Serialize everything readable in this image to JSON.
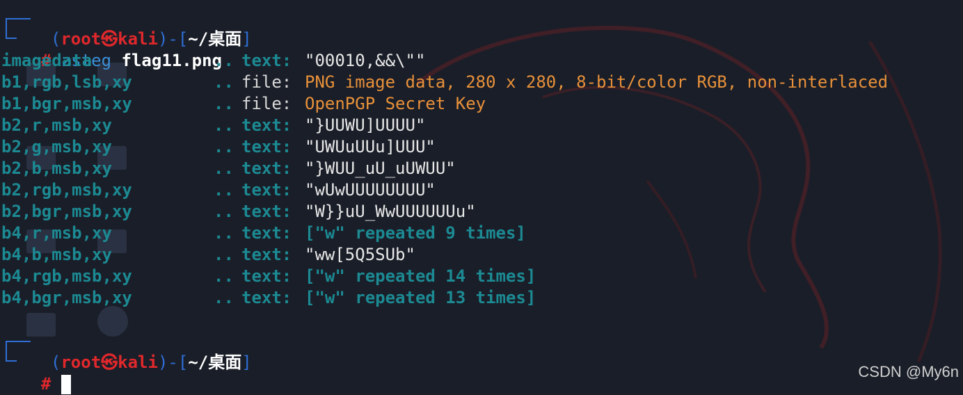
{
  "prompt": {
    "open": "(",
    "user": "root",
    "at_symbol": "㉿",
    "host": "kali",
    "sep": ")-[",
    "path": "~/桌面",
    "close": "]",
    "hash": "#"
  },
  "command": {
    "program": "zsteg",
    "argument": "flag11.png"
  },
  "results": [
    {
      "key": "imagedata",
      "dots": "..",
      "type": "text:",
      "value": "\"00010,&&\\\"\"",
      "style": "plain"
    },
    {
      "key": "b1,rgb,lsb,xy",
      "dots": "..",
      "type": "file:",
      "value": "PNG image data, 280 x 280, 8-bit/color RGB, non-interlaced",
      "style": "orange"
    },
    {
      "key": "b1,bgr,msb,xy",
      "dots": "..",
      "type": "file:",
      "value": "OpenPGP Secret Key",
      "style": "orange"
    },
    {
      "key": "b2,r,msb,xy",
      "dots": "..",
      "type": "text:",
      "value": "\"}UUWU]UUUU\"",
      "style": "plain"
    },
    {
      "key": "b2,g,msb,xy",
      "dots": "..",
      "type": "text:",
      "value": "\"UWUuUUu]UUU\"",
      "style": "plain"
    },
    {
      "key": "b2,b,msb,xy",
      "dots": "..",
      "type": "text:",
      "value": "\"}WUU_uU_uUWUU\"",
      "style": "plain"
    },
    {
      "key": "b2,rgb,msb,xy",
      "dots": "..",
      "type": "text:",
      "value": "\"wUwUUUUUUUU\"",
      "style": "plain"
    },
    {
      "key": "b2,bgr,msb,xy",
      "dots": "..",
      "type": "text:",
      "value": "\"W}}uU_WwUUUUUUu\"",
      "style": "plain"
    },
    {
      "key": "b4,r,msb,xy",
      "dots": "..",
      "type": "text:",
      "value": "[\"w\" repeated 9 times]",
      "style": "teal"
    },
    {
      "key": "b4,b,msb,xy",
      "dots": "..",
      "type": "text:",
      "value": "\"ww[5Q5SUb\"",
      "style": "plain"
    },
    {
      "key": "b4,rgb,msb,xy",
      "dots": "..",
      "type": "text:",
      "value": "[\"w\" repeated 14 times]",
      "style": "teal"
    },
    {
      "key": "b4,bgr,msb,xy",
      "dots": "..",
      "type": "text:",
      "value": "[\"w\" repeated 13 times]",
      "style": "teal"
    }
  ],
  "watermark": "CSDN @My6n",
  "colors": {
    "background": "#1a1e28",
    "accent_blue": "#2f6fd6",
    "prompt_red": "#e0282c",
    "teal": "#1c8a93",
    "orange": "#e8913a"
  }
}
